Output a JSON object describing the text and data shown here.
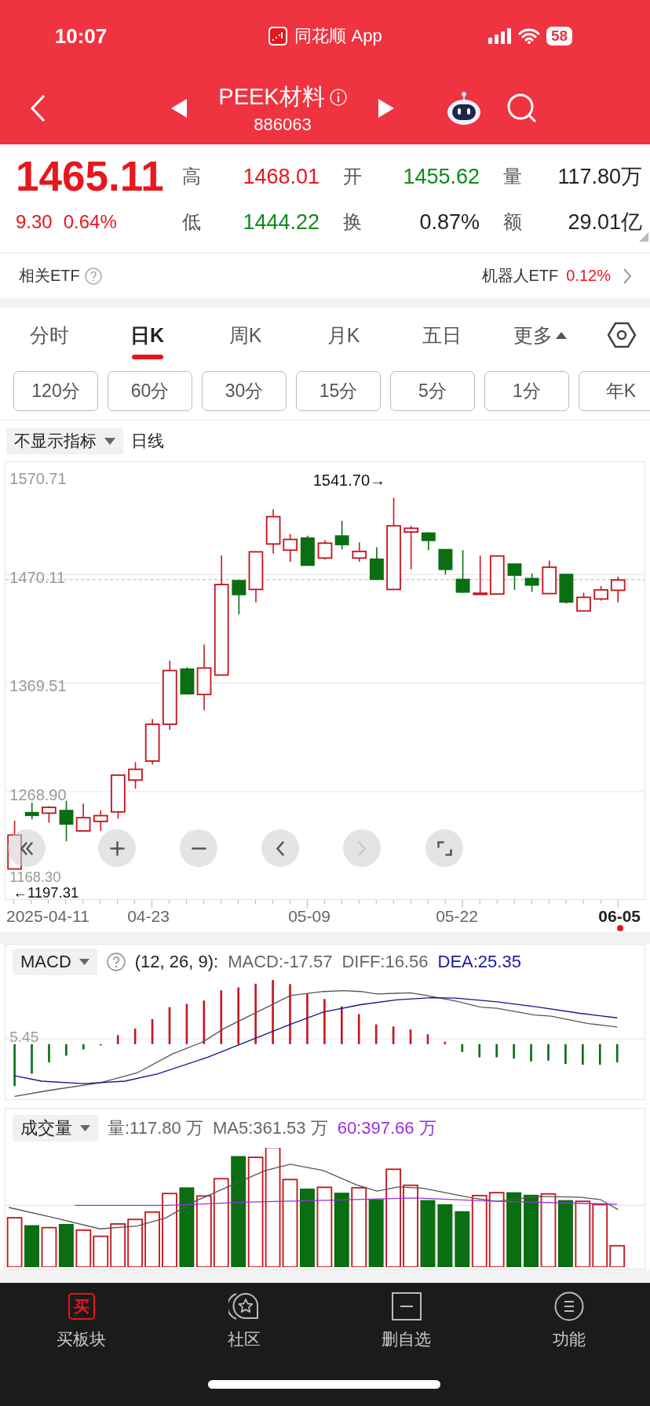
{
  "status_bar": {
    "time": "10:07",
    "app": "同花顺 App",
    "battery": "58"
  },
  "header": {
    "title": "PEEK材料",
    "code": "886063"
  },
  "quote": {
    "price": "1465.11",
    "change": "9.30",
    "change_pct": "0.64%",
    "fields": [
      {
        "label": "高",
        "value": "1468.01",
        "color": "#e8161d"
      },
      {
        "label": "开",
        "value": "1455.62",
        "color": "#0f8a1a"
      },
      {
        "label": "量",
        "value": "117.80万",
        "color": "#222222"
      },
      {
        "label": "低",
        "value": "1444.22",
        "color": "#0f8a1a"
      },
      {
        "label": "换",
        "value": "0.87%",
        "color": "#222222"
      },
      {
        "label": "额",
        "value": "29.01亿",
        "color": "#222222"
      }
    ]
  },
  "etf": {
    "label": "相关ETF",
    "name": "机器人ETF",
    "change": "0.12%"
  },
  "tabs": [
    {
      "label": "分时",
      "selected": false
    },
    {
      "label": "日K",
      "selected": true
    },
    {
      "label": "周K",
      "selected": false
    },
    {
      "label": "月K",
      "selected": false
    },
    {
      "label": "五日",
      "selected": false
    },
    {
      "label": "更多",
      "selected": false
    }
  ],
  "periods": [
    {
      "label": "120分",
      "selected": false
    },
    {
      "label": "60分",
      "selected": false
    },
    {
      "label": "30分",
      "selected": false
    },
    {
      "label": "15分",
      "selected": false
    },
    {
      "label": "5分",
      "selected": false
    },
    {
      "label": "1分",
      "selected": false
    },
    {
      "label": "年K",
      "selected": false
    }
  ],
  "indicator": {
    "label": "不显示指标",
    "line_type": "日线"
  },
  "chart": {
    "yticks": [
      "1570.71",
      "1470.11",
      "1369.51",
      "1268.90",
      "1168.30"
    ],
    "high_marker": "1541.70→",
    "low_marker": "←1197.31",
    "controls": [
      {
        "kind": "rewind",
        "disabled": false
      },
      {
        "kind": "zoom_in",
        "disabled": false
      },
      {
        "kind": "zoom_out",
        "disabled": false
      },
      {
        "kind": "prev",
        "disabled": false
      },
      {
        "kind": "next",
        "disabled": true
      },
      {
        "kind": "fullscreen",
        "disabled": false
      }
    ],
    "dates": [
      {
        "label": "2025-04-11",
        "current": false
      },
      {
        "label": "04-23",
        "current": false
      },
      {
        "label": "05-09",
        "current": false
      },
      {
        "label": "05-22",
        "current": false
      },
      {
        "label": "06-05",
        "current": true
      }
    ]
  },
  "macd": {
    "name": "MACD",
    "params": "(12, 26, 9):",
    "macd": "MACD:-17.57",
    "diff": "DIFF:16.56",
    "dea": "DEA:25.35",
    "axis_label": "5.45"
  },
  "volume": {
    "name": "成交量",
    "vol": "量:117.80 万",
    "ma5": "MA5:361.53 万",
    "ma60": "60:397.66 万"
  },
  "nav": [
    {
      "kind": "glyph",
      "glyph": "买",
      "label": "买板块",
      "selected": true
    },
    {
      "kind": "star",
      "label": "社区",
      "selected": false
    },
    {
      "kind": "minus",
      "label": "删自选",
      "selected": false
    },
    {
      "kind": "menu",
      "label": "功能",
      "selected": false
    }
  ]
}
